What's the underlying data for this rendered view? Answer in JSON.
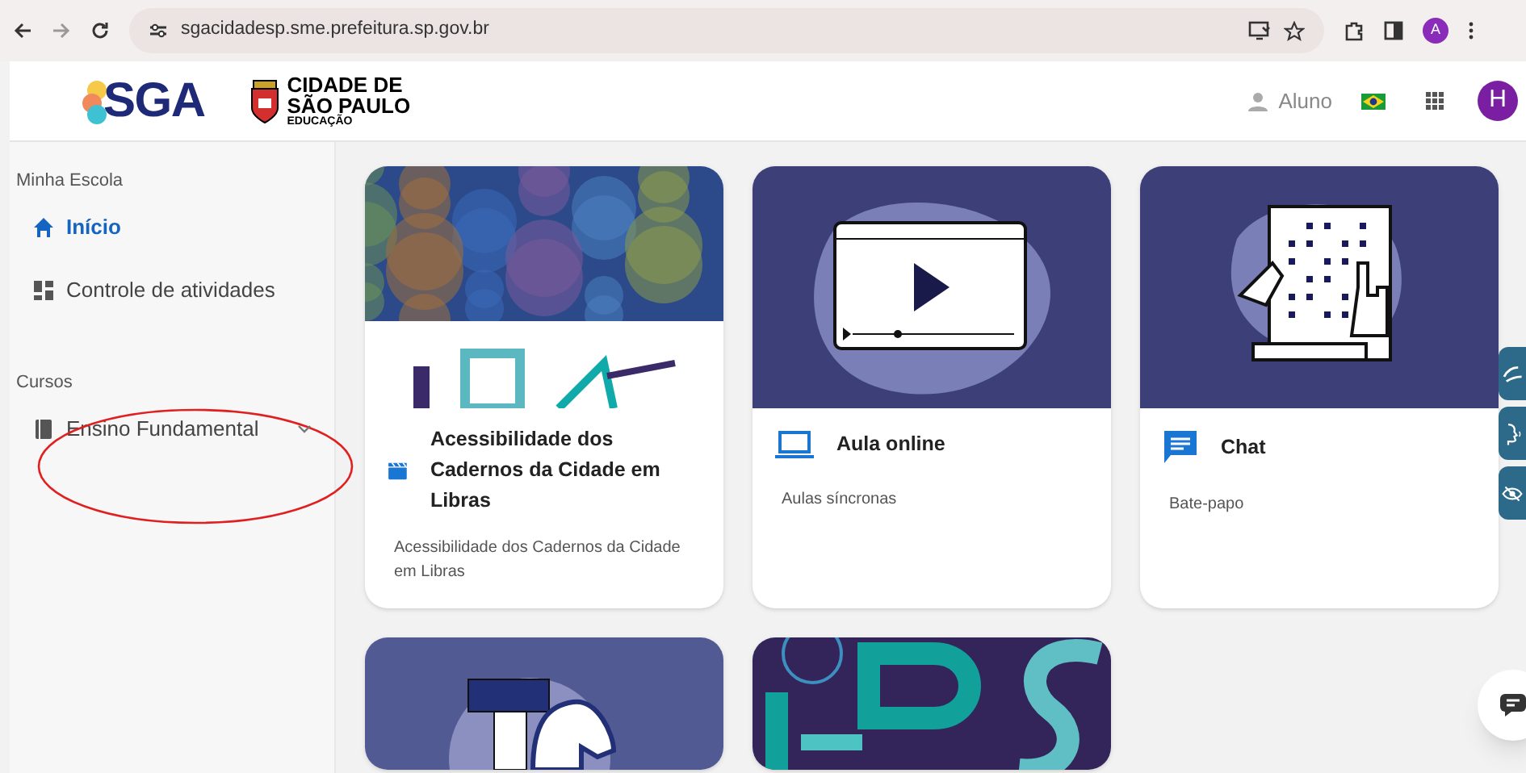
{
  "browser": {
    "url": "sgacidadesp.sme.prefeitura.sp.gov.br",
    "profile_initial": "A"
  },
  "header": {
    "logo": "SGA",
    "city_logo": [
      "CIDADE DE",
      "SÃO PAULO",
      "EDUCAÇÃO"
    ],
    "user_label": "Aluno",
    "avatar_initial": "H"
  },
  "sidebar": {
    "sections": [
      {
        "title": "Minha Escola",
        "items": [
          {
            "label": "Início",
            "kind": "home",
            "selected": true
          },
          {
            "label": "Controle de atividades",
            "kind": "dashboard",
            "selected": false
          }
        ]
      },
      {
        "title": "Cursos",
        "items": [
          {
            "label": "Ensino Fundamental",
            "kind": "book",
            "selected": false,
            "expanded": false
          }
        ]
      }
    ]
  },
  "cards": [
    {
      "kind": "libras",
      "title": "Acessibilidade dos Cadernos da Cidade em Libras",
      "subtitle": "Acessibilidade dos Cadernos da Cidade em Libras"
    },
    {
      "kind": "video",
      "title": "Aula online",
      "subtitle": "Aulas síncronas"
    },
    {
      "kind": "braille",
      "title": "Chat",
      "subtitle": "Bate-papo"
    },
    {
      "kind": "chess"
    },
    {
      "kind": "lbs"
    }
  ]
}
